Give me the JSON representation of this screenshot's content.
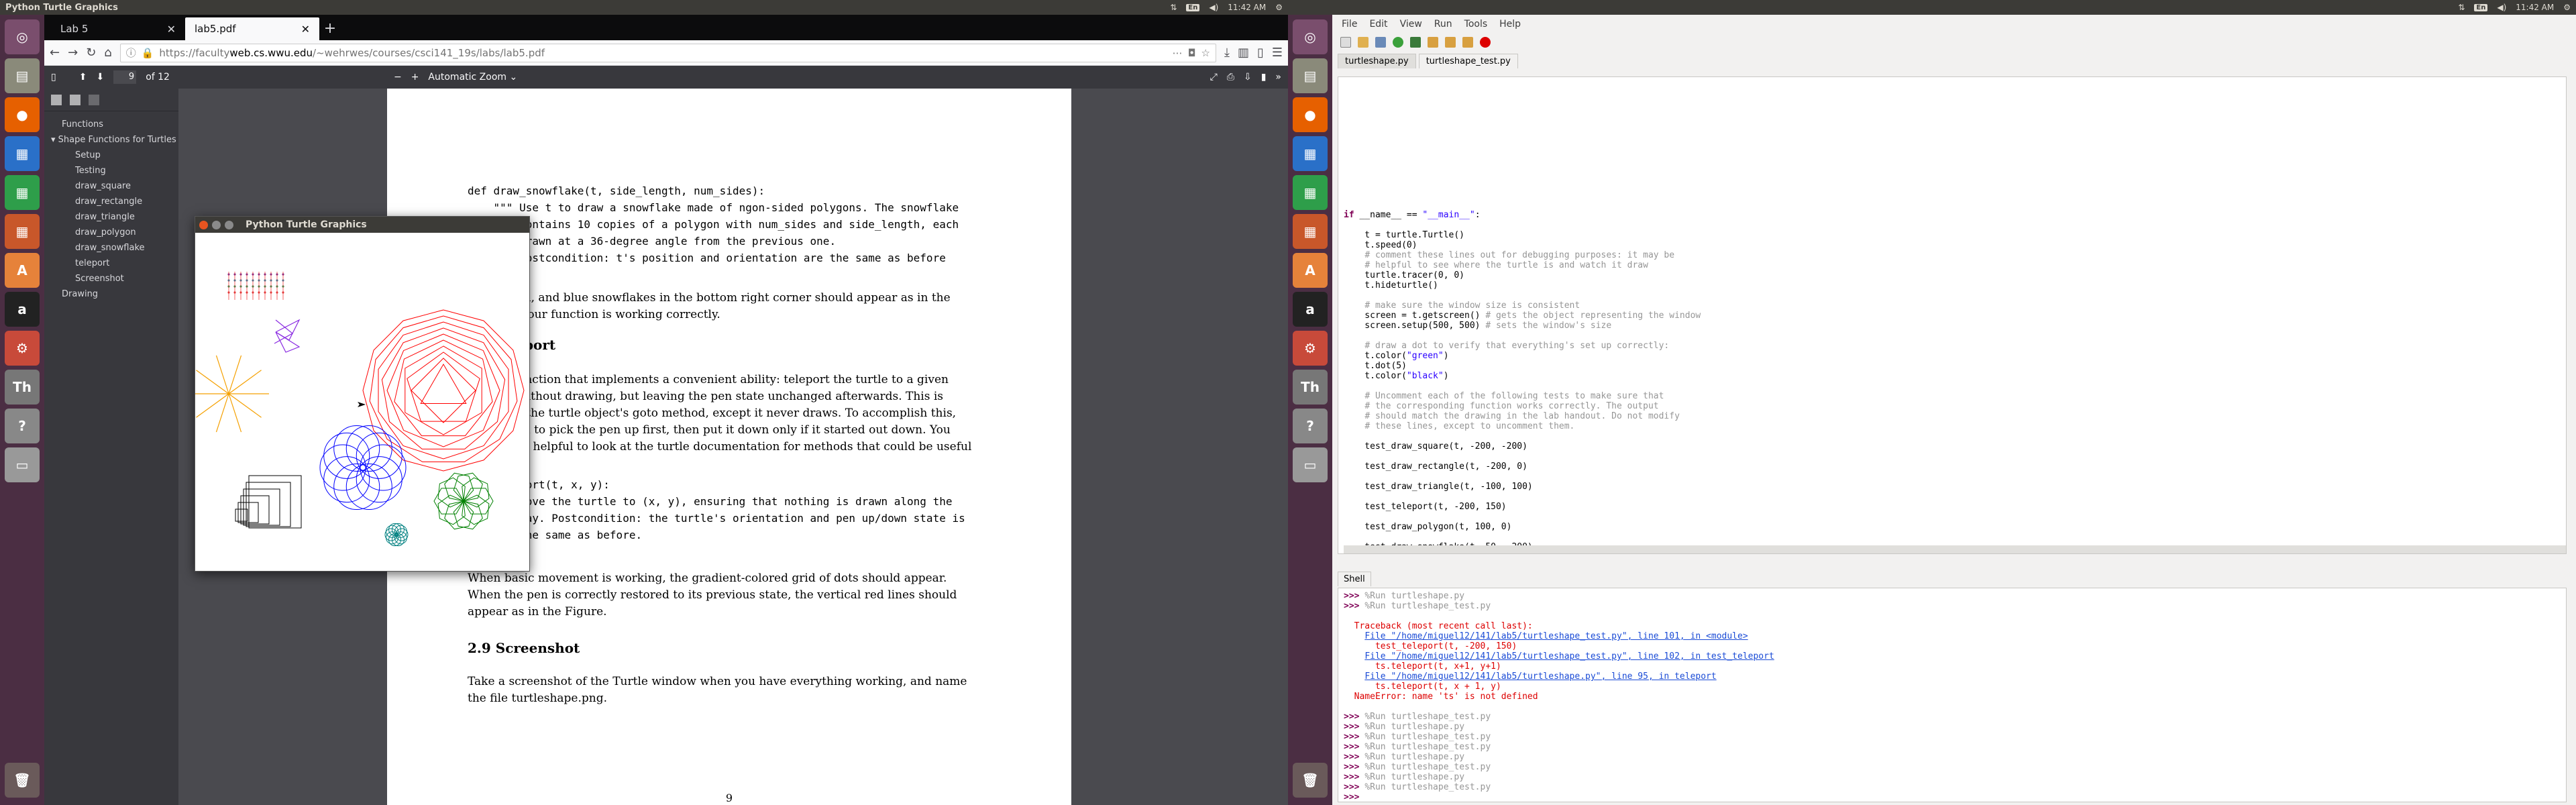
{
  "left_screen": {
    "topbar": {
      "title": "Python Turtle Graphics",
      "kbd": "En",
      "time": "11:42 AM"
    },
    "browser": {
      "tabs": [
        {
          "label": "Lab 5",
          "active": false
        },
        {
          "label": "lab5.pdf",
          "active": true
        }
      ],
      "url": {
        "prefix": "https://faculty",
        "host": "web.cs.wwu.edu",
        "path": "/~wehrwes/courses/csci141_19s/labs/lab5.pdf"
      },
      "pdf_toolbar": {
        "page": "9",
        "of": "of 12",
        "zoom": "Automatic Zoom"
      },
      "outline": [
        {
          "label": "Functions",
          "indent": 0
        },
        {
          "label": "▾ Shape Functions for Turtles",
          "indent": 0
        },
        {
          "label": "Setup",
          "indent": 1
        },
        {
          "label": "Testing",
          "indent": 1
        },
        {
          "label": "draw_square",
          "indent": 1
        },
        {
          "label": "draw_rectangle",
          "indent": 1
        },
        {
          "label": "draw_triangle",
          "indent": 1
        },
        {
          "label": "draw_polygon",
          "indent": 1
        },
        {
          "label": "draw_snowflake",
          "indent": 1
        },
        {
          "label": "teleport",
          "indent": 1
        },
        {
          "label": "Screenshot",
          "indent": 1
        },
        {
          "label": "Drawing",
          "indent": 0
        }
      ],
      "page": {
        "code1": "def draw_snowflake(t, side_length, num_sides):\n    \"\"\" Use t to draw a snowflake made of ngon-sided polygons. The snowflake\n        contains 10 copies of a polygon with num_sides and side_length, each\n        drawn at a 36-degree angle from the previous one.\n        Postcondition: t's position and orientation are the same as before\n    \"\"\"",
        "p1": "Red, green, and blue snowflakes in the bottom right corner should appear as in the Figure if your function is working correctly.",
        "h_teleport": "2.8   teleport",
        "p2": "Write a function that implements a convenient ability: teleport the turtle to a given location without drawing, but leaving the pen state unchanged afterwards. This is similar to the turtle object's goto method, except it never draws. To accomplish this, you'll need to pick the pen up first, then put it down only if it started out down. You may find it helpful to look at the turtle documentation for methods that could be useful here.",
        "code2": "def teleport(t, x, y):\n    \"\"\" Move the turtle to (x, y), ensuring that nothing is drawn along the\n        way. Postcondition: the turtle's orientation and pen up/down state is\n        the same as before.\n    \"\"\"",
        "p3": "When basic movement is working, the gradient-colored grid of dots should appear. When the pen is correctly restored to its previous state, the vertical red lines should appear as in the Figure.",
        "h_screenshot": "2.9   Screenshot",
        "p4": "Take a screenshot of the Turtle window when you have everything working, and name the file turtleshape.png.",
        "page_number": "9"
      }
    },
    "turtle_window": {
      "title": "Python Turtle Graphics"
    }
  },
  "right_screen": {
    "topbar": {
      "kbd": "En",
      "time": "11:42 AM"
    },
    "ide": {
      "menu": [
        "File",
        "Edit",
        "View",
        "Run",
        "Tools",
        "Help"
      ],
      "tabs": [
        {
          "label": "turtleshape.py",
          "active": false
        },
        {
          "label": "turtleshape_test.py",
          "active": true
        }
      ],
      "shell_label": "Shell"
    }
  },
  "colors": {
    "ubuntu_orange": "#e95420",
    "launcher": "#4b2e43",
    "firefox_dark": "#0c0c0d",
    "pdf_bg": "#4a4a4f"
  }
}
